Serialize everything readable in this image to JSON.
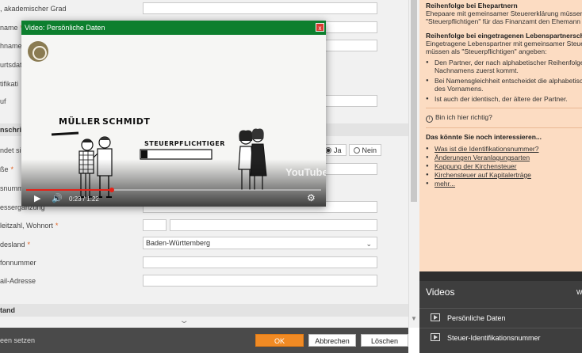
{
  "form": {
    "rows": [
      {
        "label": ", akademischer Grad",
        "required": false
      },
      {
        "label": "name",
        "required": true
      },
      {
        "label": "hname",
        "required": false
      },
      {
        "label": "urtsdat",
        "required": false
      },
      {
        "label": "tifikati",
        "required": false
      },
      {
        "label": "uf",
        "required": false
      }
    ],
    "section_address": "nschri",
    "married_label": "ndet sic",
    "radio_yes": "Ja",
    "radio_no": "Nein",
    "street_label": "ße",
    "street_required": true,
    "housenr_label": "snumm",
    "addr_suffix_label": "essergänzung",
    "zip_label": "leitzahl, Wohnort",
    "zip_required": true,
    "state_label": "desland",
    "state_required": true,
    "state_value": "Baden-Württemberg",
    "phone_label": "fonnummer",
    "email_label": "ail-Adresse",
    "section_status": "tand"
  },
  "bottombar": {
    "hint": "een setzen",
    "ok": "OK",
    "cancel": "Abbrechen",
    "delete": "Löschen"
  },
  "help": {
    "h1": "Reihenfolge bei Ehepartnern",
    "p1a": "Ehepaare mit gemeinsamer Steuererklärung müssen als",
    "p1b": "\"Steuerpflichtigen\" für das Finanzamt den Ehemann ange",
    "h2": "Reihenfolge bei eingetragenen Lebenspartnerschafte",
    "p2a": "Eingetragene Lebenspartner mit gemeinsamer Steuererk",
    "p2b": "müssen als \"Steuerpflichtigen\" angeben:",
    "b1a": "Den Partner, der nach alphabetischer Reihenfolge des",
    "b1b": "Nachnamens zuerst kommt.",
    "b2a": "Bei Namensgleichheit entscheidet die alphabetische R",
    "b2b": "des Vornamens.",
    "b3": "Ist auch der identisch, der ältere der Partner.",
    "feedback": "Bin ich hier richtig?",
    "related_title": "Das könnte Sie noch interessieren...",
    "links": [
      "Was ist die Identifikationsnummer?",
      "Änderungen Veranlagungsarten",
      "Kappung der Kirchensteuer",
      "Kirchensteuer auf Kapitalerträge",
      "mehr..."
    ]
  },
  "videos": {
    "title": "Videos",
    "extra": "W",
    "items": [
      "Persönliche Daten",
      "Steuer-Identifikationsnummer"
    ]
  },
  "popup": {
    "title": "Video: Persönliche Daten",
    "close": "x",
    "name1": "MÜLLER",
    "name2": "SCHMIDT",
    "board": "STEUERPFLICHTIGER",
    "watermark": "YouTube",
    "time": "0:23 / 1:22",
    "progress": 0.29
  },
  "colors": {
    "accent": "#f08a24",
    "popup_titlebar": "#0d7f2e",
    "help_bg": "#fcdcc2"
  }
}
